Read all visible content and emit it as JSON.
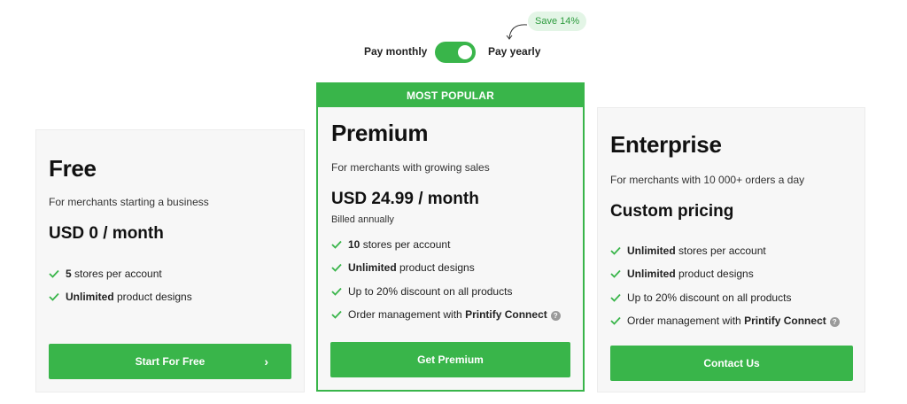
{
  "toggle": {
    "monthly_label": "Pay monthly",
    "yearly_label": "Pay yearly",
    "save_badge": "Save 14%",
    "state": "yearly"
  },
  "colors": {
    "accent": "#39b54a",
    "card_bg": "#f7f7f7",
    "badge_bg": "#e3f5e6"
  },
  "plans": {
    "free": {
      "name": "Free",
      "description": "For merchants starting a business",
      "price": "USD 0 / month",
      "features": [
        {
          "bold": "5",
          "text": " stores per account"
        },
        {
          "bold": "Unlimited",
          "text": " product designs"
        }
      ],
      "cta": "Start For Free",
      "cta_icon": "chevron-right-icon"
    },
    "premium": {
      "banner": "MOST POPULAR",
      "name": "Premium",
      "description": "For merchants with growing sales",
      "price": "USD 24.99 / month",
      "billed": "Billed annually",
      "features": [
        {
          "bold": "10",
          "text": " stores per account"
        },
        {
          "bold": "Unlimited",
          "text": " product designs"
        },
        {
          "text": "Up to 20% discount on all products"
        },
        {
          "text": "Order management with ",
          "bold_after": "Printify Connect"
        }
      ],
      "cta": "Get Premium"
    },
    "enterprise": {
      "name": "Enterprise",
      "description": "For merchants with 10 000+ orders a day",
      "price": "Custom pricing",
      "features": [
        {
          "bold": "Unlimited",
          "text": " stores per account"
        },
        {
          "bold": "Unlimited",
          "text": " product designs"
        },
        {
          "text": "Up to 20% discount on all products"
        },
        {
          "text": "Order management with ",
          "bold_after": "Printify Connect"
        }
      ],
      "cta": "Contact Us"
    }
  }
}
